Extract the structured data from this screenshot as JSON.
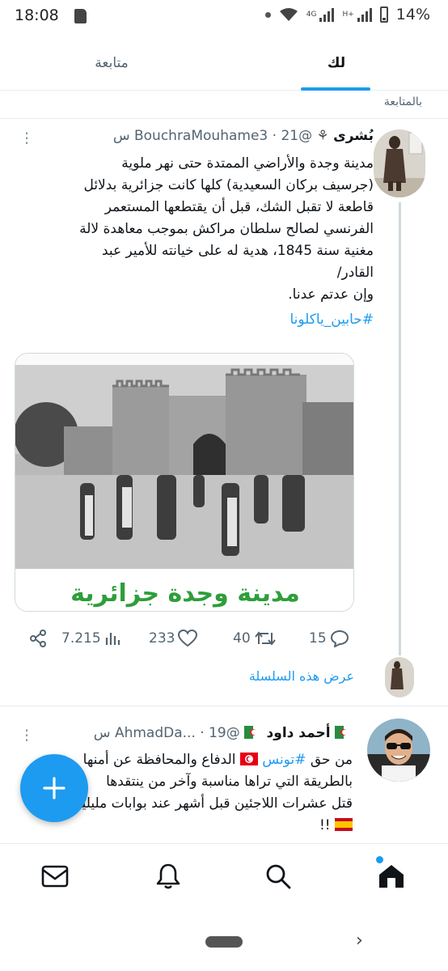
{
  "status_bar": {
    "time": "18:08",
    "network_1": "4G",
    "network_2": "H+",
    "battery": "14%"
  },
  "tabs": [
    {
      "label": "لك",
      "selected": true
    },
    {
      "label": "متابعة",
      "selected": false
    }
  ],
  "section_label": "بالمتابعة",
  "tweets": [
    {
      "display_name": "بُشرى",
      "handle": "@BouchraMouhame3",
      "time": "21 س",
      "text_lines": [
        "مدينة وجدة والأراضي الممتدة حتى نهر ملوية",
        "(جرسيف بركان السعيدية) كلها كانت جزائرية بدلائل",
        "قاطعة لا تقبل الشك، قبل أن يقتطعها المستعمر",
        "الفرنسي لصالح سلطان مراكش بموجب معاهدة لالة",
        "مغنية سنة 1845، هدية له على خيانته للأمير عبد",
        "القادر/",
        "وإن عدتم عدنا."
      ],
      "hashtag": "#حابين_ياكلونا",
      "image_caption": "مدينة وجدة جزائرية",
      "replies": "15",
      "retweets": "40",
      "likes": "233",
      "views": "7.215",
      "show_thread": "عرض هذه السلسلة"
    },
    {
      "display_name": "أحمد داود",
      "handle": "@AhmadDa...",
      "time": "19 س",
      "line1_before": "من حق",
      "line1_hashtag": "#تونس",
      "line1_after": "الدفاع والمحافظة عن أمنها",
      "line2": "بالطريقة التي تراها مناسبة وآخر من ينتقدها",
      "line3": "قتل عشرات اللاجئين قبل أشهر عند بوابات مليلية",
      "line4": "!!"
    }
  ],
  "colors": {
    "accent": "#1d9bf0",
    "text": "#0f1419",
    "muted": "#536471",
    "caption_green": "#2e9e3a"
  },
  "icons": [
    "mail-icon",
    "bell-icon",
    "search-icon",
    "home-icon",
    "plus-icon",
    "share-icon",
    "views-icon",
    "heart-icon",
    "retweet-icon",
    "reply-icon"
  ]
}
